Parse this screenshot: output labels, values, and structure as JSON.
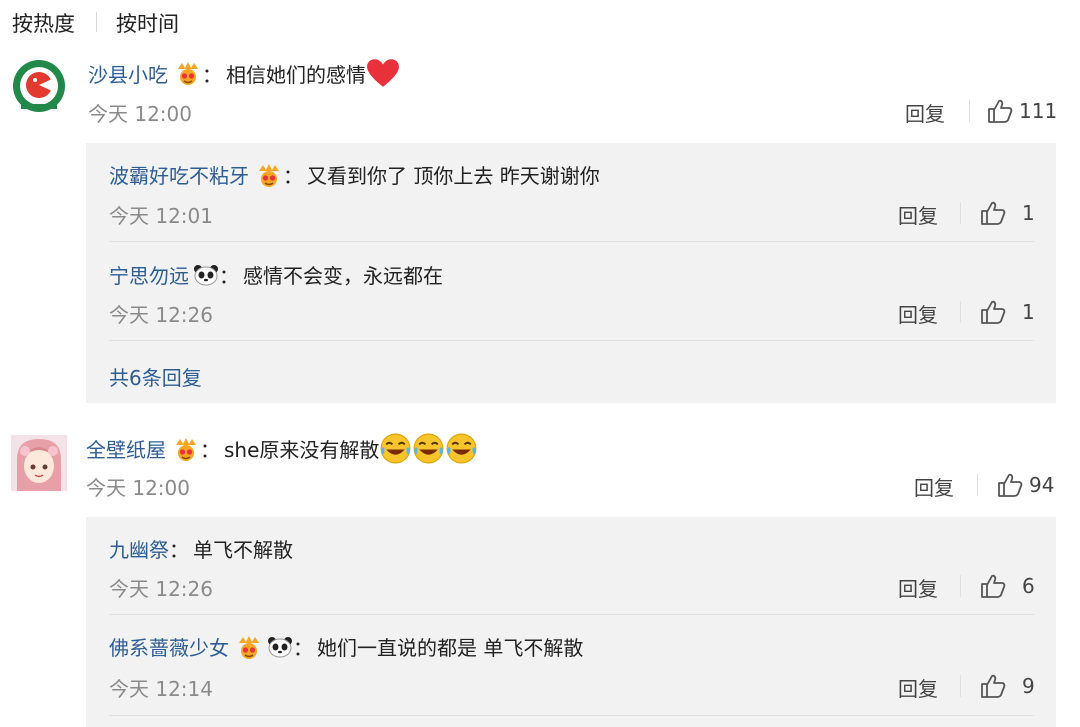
{
  "sort": {
    "hot": "按热度",
    "time": "按时间"
  },
  "comments": [
    {
      "user": "沙县小吃",
      "text": "相信她们的感情",
      "time": "今天 12:00",
      "reply_label": "回复",
      "likes": "111",
      "replies": [
        {
          "user": "波霸好吃不粘牙",
          "text": "又看到你了 顶你上去 昨天谢谢你",
          "time": "今天 12:01",
          "reply_label": "回复",
          "likes": "1"
        },
        {
          "user": "宁思勿远",
          "text": "感情不会变，永远都在",
          "time": "今天 12:26",
          "reply_label": "回复",
          "likes": "1"
        }
      ],
      "more_replies": "共6条回复"
    },
    {
      "user": "全壁纸屋",
      "text": "she原来没有解散",
      "time": "今天 12:00",
      "reply_label": "回复",
      "likes": "94",
      "replies": [
        {
          "user": "九幽祭",
          "text": "单飞不解散",
          "time": "今天 12:26",
          "reply_label": "回复",
          "likes": "6"
        },
        {
          "user": "佛系蔷薇少女",
          "text": "她们一直说的都是 单飞不解散",
          "time": "今天 12:14",
          "reply_label": "回复",
          "likes": "9"
        }
      ]
    }
  ],
  "colors": {
    "nickname": "#2d5d95",
    "subpanel": "#f2f2f2",
    "time": "#8a8a8a"
  }
}
